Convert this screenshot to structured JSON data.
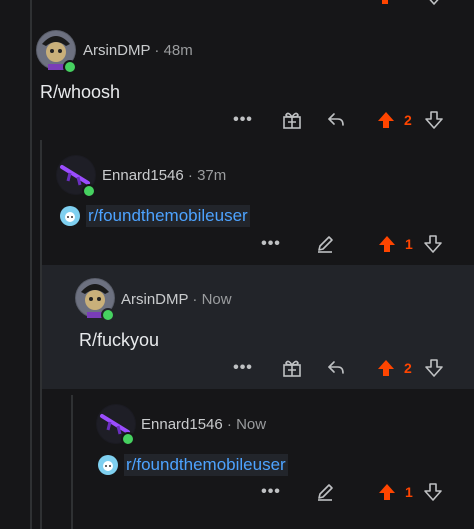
{
  "comments": [
    {
      "username": "ArsinDMP",
      "time": "48m",
      "text": "R/whoosh",
      "score": "2"
    },
    {
      "username": "Ennard1546",
      "time": "37m",
      "link": "r/foundthemobileuser",
      "score": "1"
    },
    {
      "username": "ArsinDMP",
      "time": "Now",
      "text": "R/fuckyou",
      "score": "2"
    },
    {
      "username": "Ennard1546",
      "time": "Now",
      "link": "r/foundthemobileuser",
      "score": "1"
    }
  ],
  "separator": "·",
  "more_label": "•••",
  "colors": {
    "upvote": "#ff4500",
    "link": "#4da3ff",
    "online": "#46d160"
  }
}
